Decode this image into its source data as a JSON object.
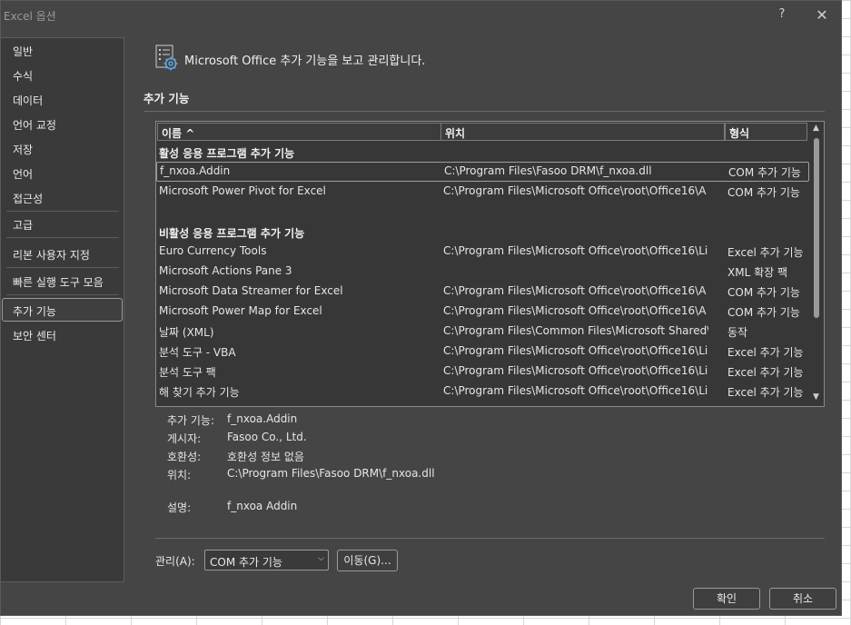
{
  "window": {
    "title": "Excel 옵션",
    "help": "?",
    "close": "✕"
  },
  "nav": {
    "items": [
      {
        "label": "일반"
      },
      {
        "label": "수식"
      },
      {
        "label": "데이터"
      },
      {
        "label": "언어 교정"
      },
      {
        "label": "저장"
      },
      {
        "label": "언어"
      },
      {
        "label": "접근성"
      },
      {
        "label": "고급"
      },
      {
        "label": "리본 사용자 지정"
      },
      {
        "label": "빠른 실행 도구 모음"
      },
      {
        "label": "추가 기능"
      },
      {
        "label": "보안 센터"
      }
    ],
    "selected": "추가 기능"
  },
  "header": {
    "text": "Microsoft Office 추가 기능을 보고 관리합니다.",
    "icon": "addins-gear-icon"
  },
  "section": {
    "title": "추가 기능"
  },
  "list": {
    "columns": [
      "이름 ^",
      "위치",
      "형식"
    ],
    "active_group": "활성 응용 프로그램 추가 기능",
    "active": [
      {
        "name": "f_nxoa.Addin",
        "location": "C:\\Program Files\\Fasoo DRM\\f_nxoa.dll",
        "type": "COM 추가 기능"
      },
      {
        "name": "Microsoft Power Pivot for Excel",
        "location": "C:\\Program Files\\Microsoft Office\\root\\Office16\\A",
        "type": "COM 추가 기능"
      }
    ],
    "inactive_group": "비활성 응용 프로그램 추가 기능",
    "inactive": [
      {
        "name": "Euro Currency Tools",
        "location": "C:\\Program Files\\Microsoft Office\\root\\Office16\\Li",
        "type": "Excel 추가 기능"
      },
      {
        "name": "Microsoft Actions Pane 3",
        "location": "",
        "type": "XML 확장 팩"
      },
      {
        "name": "Microsoft Data Streamer for Excel",
        "location": "C:\\Program Files\\Microsoft Office\\root\\Office16\\A",
        "type": "COM 추가 기능"
      },
      {
        "name": "Microsoft Power Map for Excel",
        "location": "C:\\Program Files\\Microsoft Office\\root\\Office16\\A",
        "type": "COM 추가 기능"
      },
      {
        "name": "날짜 (XML)",
        "location": "C:\\Program Files\\Common Files\\Microsoft Shared\\",
        "type": "동작"
      },
      {
        "name": "분석 도구 - VBA",
        "location": "C:\\Program Files\\Microsoft Office\\root\\Office16\\Li",
        "type": "Excel 추가 기능"
      },
      {
        "name": "분석 도구 팩",
        "location": "C:\\Program Files\\Microsoft Office\\root\\Office16\\Li",
        "type": "Excel 추가 기능"
      },
      {
        "name": "해 찾기 추가 기능",
        "location": "C:\\Program Files\\Microsoft Office\\root\\Office16\\Li",
        "type": "Excel 추가 기능"
      }
    ],
    "selected_index": 0
  },
  "details": {
    "addin_label": "추가 기능:",
    "addin_value": "f_nxoa.Addin",
    "publisher_label": "게시자:",
    "publisher_value": "Fasoo Co., Ltd.",
    "compat_label": "호환성:",
    "compat_value": "호환성 정보 없음",
    "location_label": "위치:",
    "location_value": "C:\\Program Files\\Fasoo DRM\\f_nxoa.dll",
    "desc_label": "설명:",
    "desc_value": "f_nxoa Addin"
  },
  "manage": {
    "label": "관리(A):",
    "select_value": "COM 추가 기능",
    "go_button": "이동(G)..."
  },
  "footer": {
    "ok": "확인",
    "cancel": "취소"
  }
}
